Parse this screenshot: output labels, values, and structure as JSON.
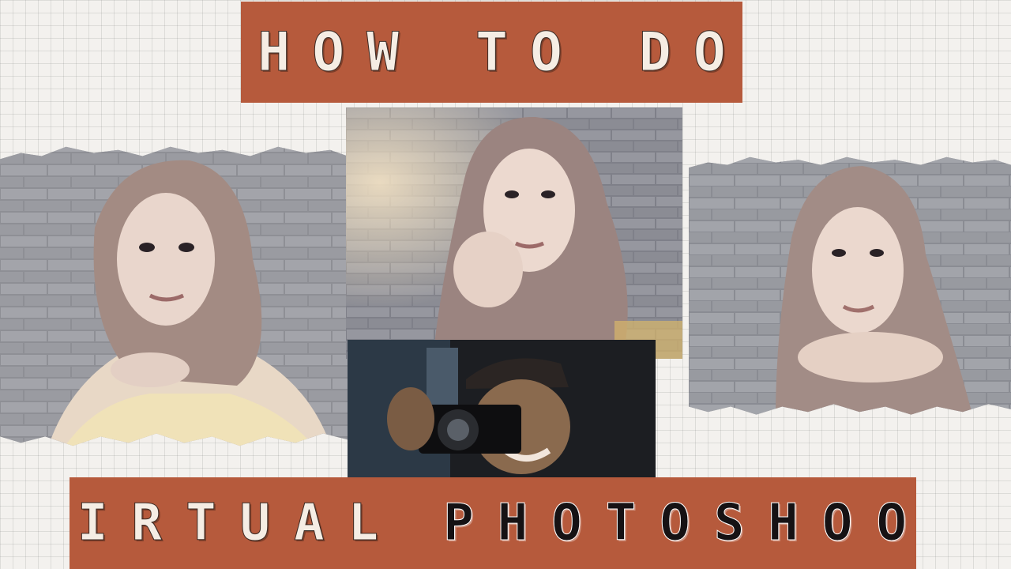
{
  "title": {
    "line1": "HOW TO DO",
    "line2_word1": "VIRTUAL",
    "line2_word2": "PHOTOSHOOT"
  },
  "colors": {
    "banner": "#b65a3c",
    "banner_text_light": "#f5ede4",
    "banner_text_dark": "#161214",
    "background": "#f3f1ee",
    "brick_wall": "#8f9096"
  },
  "photos": [
    {
      "subject": "woman-in-hijab-portrait"
    },
    {
      "subject": "woman-in-hijab-hand-on-chin"
    },
    {
      "subject": "woman-in-hijab-hands-under-chin"
    },
    {
      "subject": "photographer-with-camera-on-video-call"
    }
  ]
}
